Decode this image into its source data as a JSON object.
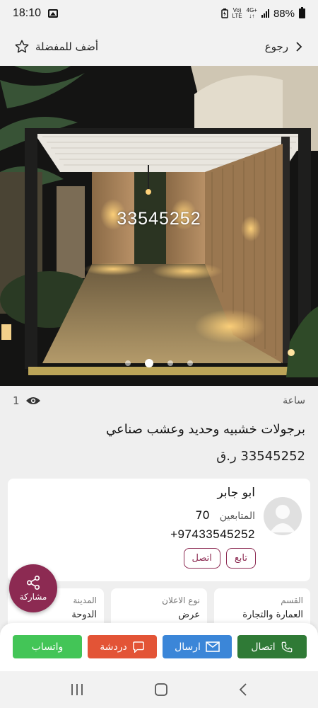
{
  "status_bar": {
    "time": "18:10",
    "network_top": "Vo)",
    "network_bottom": "LTE",
    "net_gen": "4G+",
    "battery": "88%"
  },
  "nav": {
    "back_label": "رجوع",
    "favorite_label": "أضف للمفضلة"
  },
  "gallery": {
    "overlay_text": "33545252",
    "dots": 4,
    "active_index": 1
  },
  "listing": {
    "time_ago": "ساعة",
    "views": "1",
    "title": "برجولات خشبيه وحديد وعشب صناعي",
    "price": "33545252 ر.ق"
  },
  "seller": {
    "name": "ابو جابر",
    "followers_label": "المتابعين",
    "followers_count": "70",
    "phone": "+97433545252",
    "follow_label": "تابع",
    "call_label": "اتصل"
  },
  "info": [
    {
      "label": "القسم",
      "value": "العمارة والتجارة"
    },
    {
      "label": "نوع الاعلان",
      "value": "عرض"
    },
    {
      "label": "المدينة",
      "value": "الدوحة"
    }
  ],
  "share": {
    "label": "مشاركة"
  },
  "actions": {
    "call": "اتصال",
    "send": "ارسال",
    "chat": "دردشة",
    "whatsapp": "واتساب"
  },
  "colors": {
    "brand": "#8c2a52",
    "call": "#2f7a36",
    "send": "#3b86d8",
    "chat": "#e35436",
    "whatsapp": "#43c557"
  }
}
